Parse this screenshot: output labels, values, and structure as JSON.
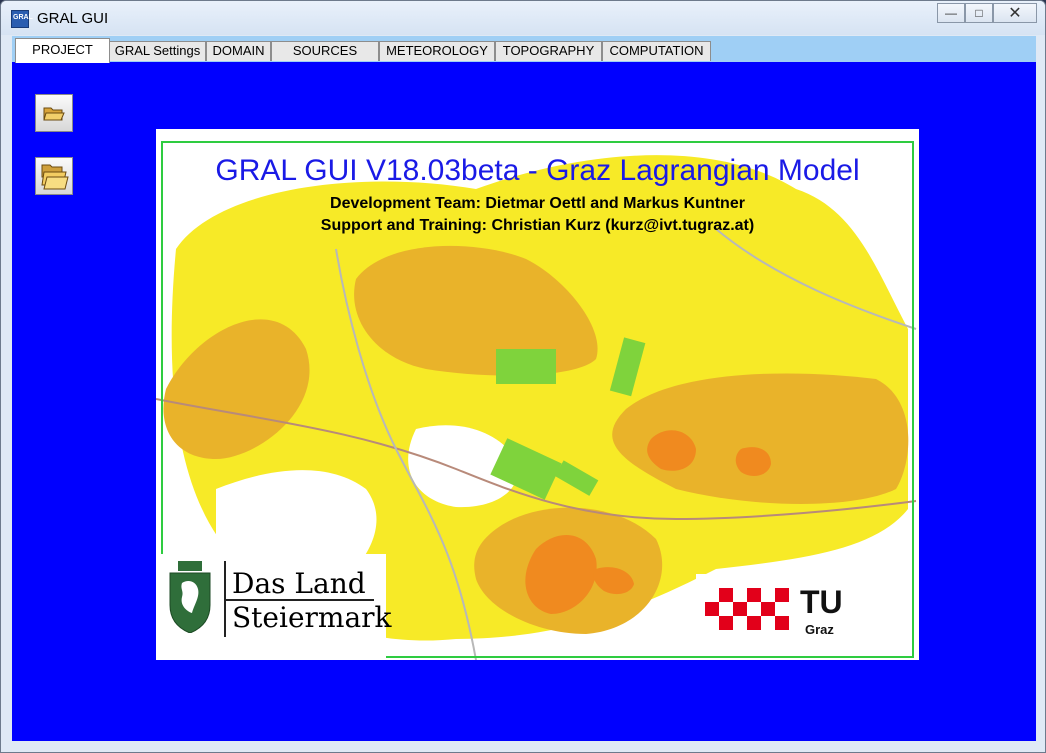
{
  "window": {
    "title": "GRAL GUI",
    "app_icon_text": "GRAL"
  },
  "tabs": [
    {
      "label": "PROJECT"
    },
    {
      "label": "GRAL Settings"
    },
    {
      "label": "DOMAIN"
    },
    {
      "label": "SOURCES"
    },
    {
      "label": "METEOROLOGY"
    },
    {
      "label": "TOPOGRAPHY"
    },
    {
      "label": "COMPUTATION"
    }
  ],
  "side_buttons": [
    {
      "icon": "open-folder-icon"
    },
    {
      "icon": "open-project-folders-icon"
    }
  ],
  "splash": {
    "title": "GRAL GUI V18.03beta - Graz Lagrangian Model",
    "team": "Development Team: Dietmar Oettl and Markus Kuntner",
    "support": "Support and Training: Christian Kurz (kurz@ivt.tugraz.at)",
    "logo_land": "Das Land Steiermark",
    "logo_land_line1": "Das Land",
    "logo_land_line2": "Steiermark",
    "logo_tu": "TU",
    "logo_tu_sub": "Graz"
  },
  "colors": {
    "background": "#0000ff",
    "tabbar": "#9fcff5",
    "title_text": "#1a1ae6",
    "map_yellow": "#f7ea27",
    "map_orange": "#e9b32a",
    "map_dark_orange": "#f08a1f",
    "buildings": "#7fd33c",
    "tu_red": "#e2001a"
  }
}
